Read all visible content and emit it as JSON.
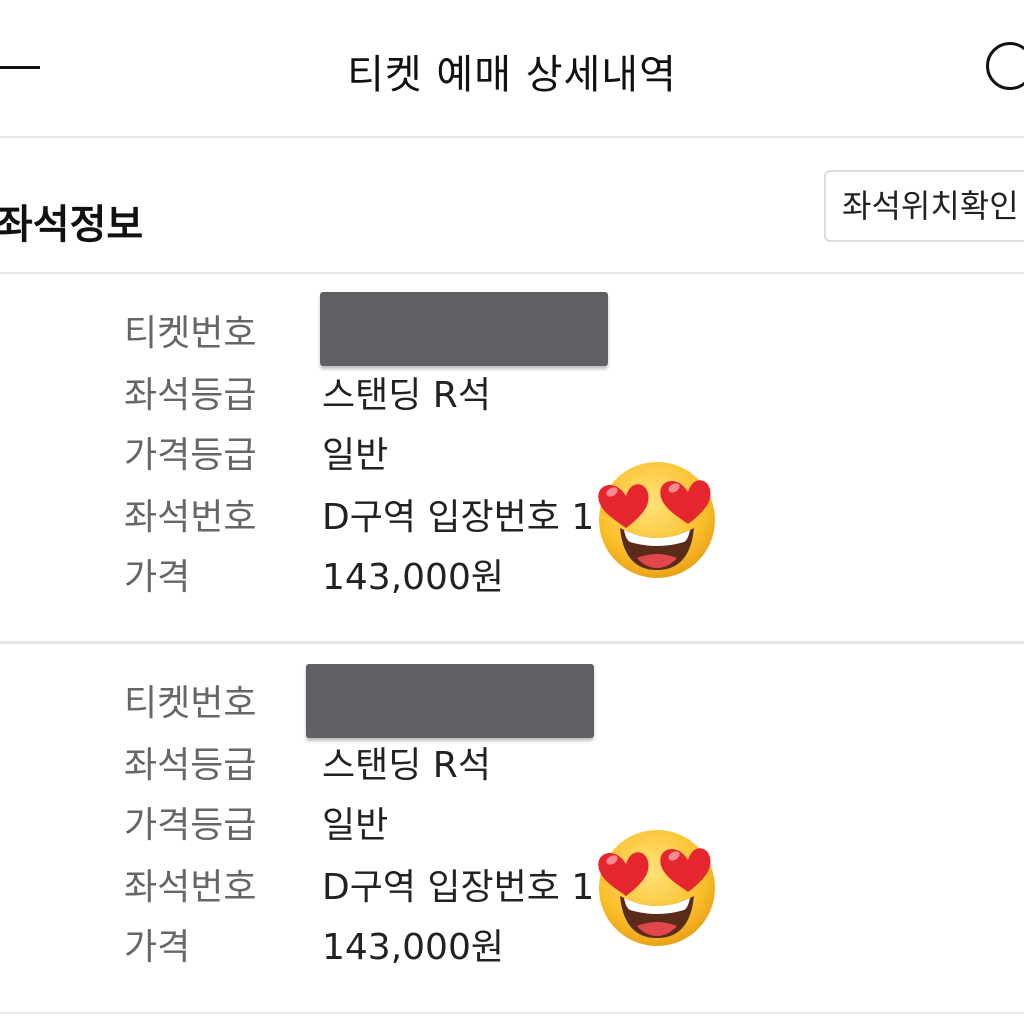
{
  "header": {
    "title": "티켓 예매 상세내역",
    "back_icon": "back-icon",
    "right_icon": "circle-icon"
  },
  "section": {
    "title": "좌석정보",
    "seat_location_button": "좌석위치확인"
  },
  "tickets": [
    {
      "rows": [
        {
          "label": "티켓번호",
          "value": ""
        },
        {
          "label": "좌석등급",
          "value": "스탠딩 R석"
        },
        {
          "label": "가격등급",
          "value": "일반"
        },
        {
          "label": "좌석번호",
          "value": "D구역 입장번호 1"
        },
        {
          "label": "가격",
          "value": "143,000원"
        }
      ],
      "ticket_number_redacted": true
    },
    {
      "rows": [
        {
          "label": "티켓번호",
          "value": ""
        },
        {
          "label": "좌석등급",
          "value": "스탠딩 R석"
        },
        {
          "label": "가격등급",
          "value": "일반"
        },
        {
          "label": "좌석번호",
          "value": "D구역 입장번호 1"
        },
        {
          "label": "가격",
          "value": "143,000원"
        }
      ],
      "ticket_number_redacted": true
    }
  ],
  "overlay_icons": [
    "heart-eyes-emoji-icon",
    "heart-eyes-emoji-icon"
  ],
  "colors": {
    "redaction": "#5f6063",
    "label_text": "#666666",
    "value_text": "#222222",
    "divider": "#e6e6e6"
  }
}
